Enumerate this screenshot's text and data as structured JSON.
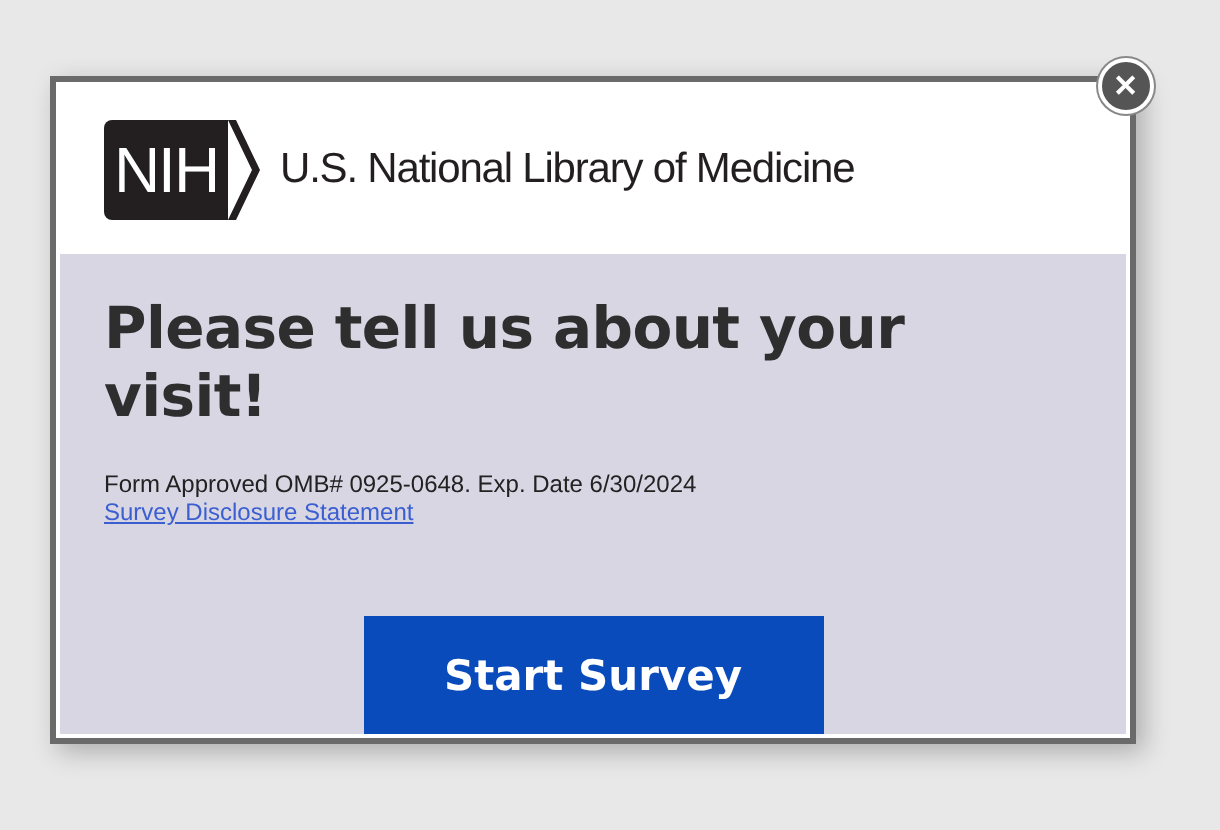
{
  "logo": {
    "badge": "NIH",
    "name": "U.S. National Library of Medicine"
  },
  "close_button": {
    "label": "✕"
  },
  "heading": "Please tell us about your visit!",
  "notice": "Form Approved OMB# 0925-0648. Exp. Date 6/30/2024",
  "link": "Survey Disclosure Statement",
  "button": "Start Survey"
}
